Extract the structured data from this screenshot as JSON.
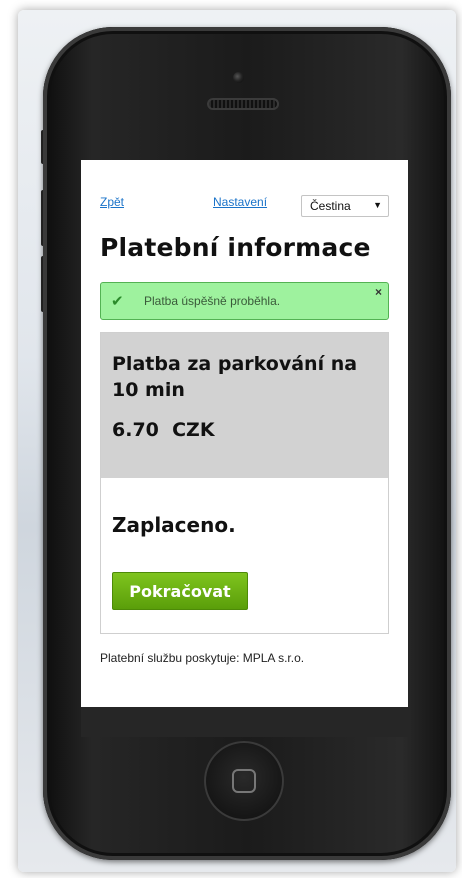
{
  "nav": {
    "back_label": "Zpět",
    "settings_label": "Nastavení",
    "language_selected": "Čestina"
  },
  "page_title": "Platební informace",
  "alert": {
    "message": "Platba úspěšně proběhla.",
    "check_icon": "✔",
    "close_icon": "×",
    "color": "#9ef29e"
  },
  "payment": {
    "title": "Platba za parkování na 10 min",
    "price": "6.70  CZK",
    "status": "Zaplaceno.",
    "continue_label": "Pokračovat",
    "button_color": "#6cb214"
  },
  "footer": {
    "provider_text": "Platební službu poskytuje: MPLA s.r.o."
  }
}
